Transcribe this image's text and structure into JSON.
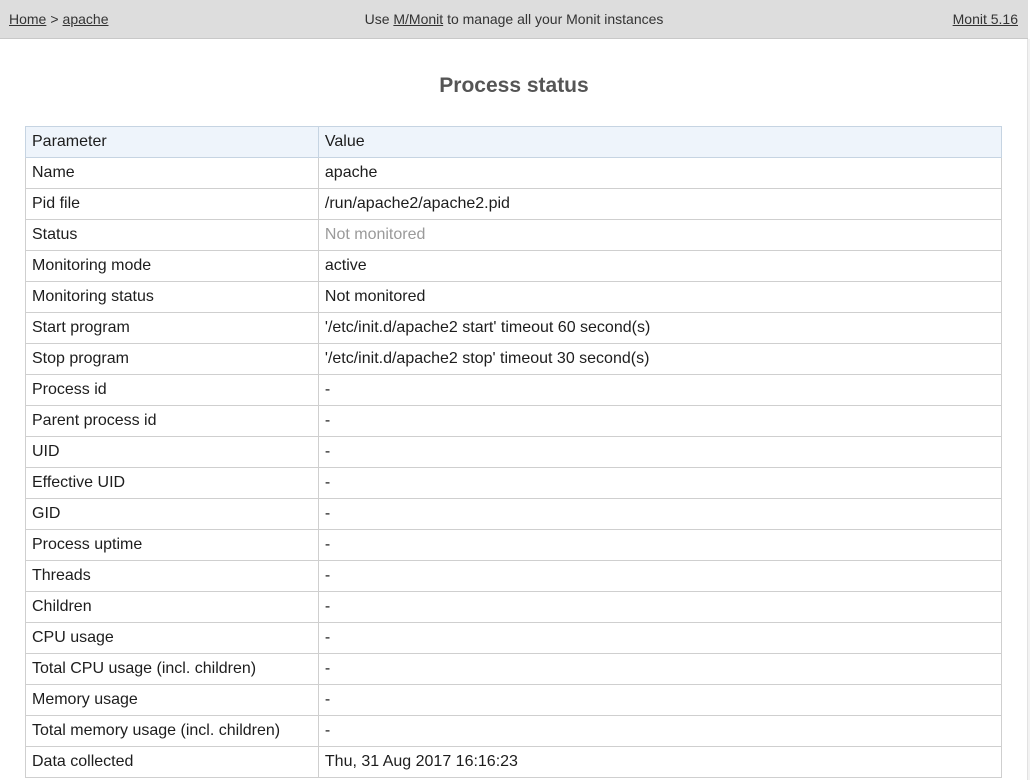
{
  "nav": {
    "home_label": "Home",
    "separator": ">",
    "current_label": "apache",
    "message_prefix": "Use",
    "message_link": "M/Monit",
    "message_suffix": "to manage all your Monit instances",
    "version_label": "Monit 5.16"
  },
  "page": {
    "title": "Process status"
  },
  "table": {
    "headers": [
      "Parameter",
      "Value"
    ],
    "rows": [
      {
        "param": "Name",
        "value": "apache"
      },
      {
        "param": "Pid file",
        "value": "/run/apache2/apache2.pid"
      },
      {
        "param": "Status",
        "value": "Not monitored"
      },
      {
        "param": "Monitoring mode",
        "value": "active"
      },
      {
        "param": "Monitoring status",
        "value": "Not monitored"
      },
      {
        "param": "Start program",
        "value": "'/etc/init.d/apache2 start' timeout 60 second(s)"
      },
      {
        "param": "Stop program",
        "value": "'/etc/init.d/apache2 stop' timeout 30 second(s)"
      },
      {
        "param": "Process id",
        "value": "-"
      },
      {
        "param": "Parent process id",
        "value": "-"
      },
      {
        "param": "UID",
        "value": "-"
      },
      {
        "param": "Effective UID",
        "value": "-"
      },
      {
        "param": "GID",
        "value": "-"
      },
      {
        "param": "Process uptime",
        "value": "-"
      },
      {
        "param": "Threads",
        "value": "-"
      },
      {
        "param": "Children",
        "value": "-"
      },
      {
        "param": "CPU usage",
        "value": "-"
      },
      {
        "param": "Total CPU usage (incl. children)",
        "value": "-"
      },
      {
        "param": "Memory usage",
        "value": "-"
      },
      {
        "param": "Total memory usage (incl. children)",
        "value": "-"
      },
      {
        "param": "Data collected",
        "value": "Thu, 31 Aug 2017 16:16:23"
      }
    ]
  },
  "colors": {
    "topbar_background": "#dddddd",
    "header_row_background": "#eef4fb",
    "muted_status_text": "#9a9a9a"
  }
}
